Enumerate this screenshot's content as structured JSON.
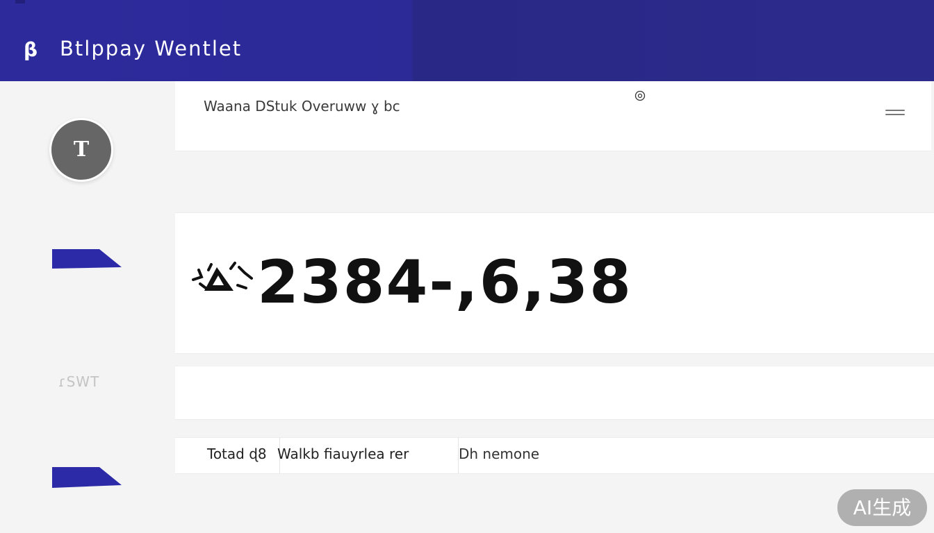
{
  "header": {
    "brand_icon": "β",
    "brand_title": "Btlppay Wentlet"
  },
  "sidebar": {
    "avatar_initial": "T",
    "nav_label": "ɾSWT",
    "accent_color": "#2d2aa8"
  },
  "overview": {
    "title": "Waana DStuk Overuww ɣ bc",
    "info_icon": "info-icon",
    "menu_icon": "menu-icon"
  },
  "balance": {
    "icon": "wallet-emblem-icon",
    "value": "2384-,6,38"
  },
  "table": {
    "columns": [
      "Totad ɖ8",
      "Walkb  fiauyrlea  rer",
      "Dh nemone"
    ]
  },
  "badge": {
    "label": "AI生成"
  }
}
